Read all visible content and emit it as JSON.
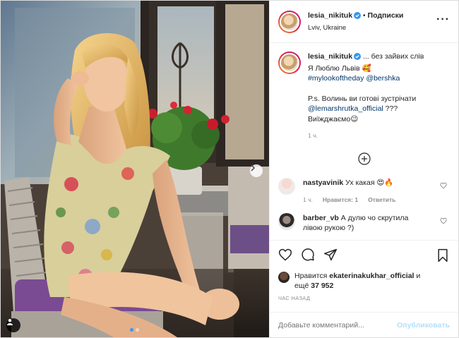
{
  "header": {
    "username": "lesia_nikituk",
    "separator": "•",
    "follow_label": "Подписки",
    "location": "Lviv, Ukraine"
  },
  "caption": {
    "username": "lesia_nikituk",
    "line1": " ... без зайвих слів",
    "line2": "Я Люблю Львів",
    "line2_emoji": "🥰",
    "hashtag": "#mylookoftheday",
    "mention": "@bershka",
    "line4": "P.s. Волинь ви готові зустрічати",
    "mention2": "@lemarshrutka_official",
    "line5_suffix": " ???",
    "line6": "Виїжджаємо",
    "line6_emoji": "😉",
    "time": "1 ч."
  },
  "comments": [
    {
      "username": "nastyavinik",
      "text": " Ух какая ",
      "emoji": "😍🔥",
      "time": "1 ч.",
      "likes": "Нравится: 1",
      "reply": "Ответить"
    },
    {
      "username": "barber_vb",
      "text": " А дулю чо скрутила лівою рукою ?)"
    }
  ],
  "likes": {
    "prefix": "Нравится ",
    "user": "ekaterinakukhar_official",
    "middle": " и",
    "count_prefix": "ещё ",
    "count": "37 952"
  },
  "timestamp": "ЧАС НАЗАД",
  "add_comment": {
    "placeholder": "Добавьте комментарий...",
    "post_label": "Опубликовать"
  },
  "colors": {
    "link": "#00376b",
    "verified": "#3897f0",
    "post_disabled": "#b2dffc",
    "muted": "#8e8e8e"
  },
  "icons": [
    "verified-icon",
    "more-icon",
    "add-circle-icon",
    "heart-icon",
    "comment-icon",
    "share-icon",
    "bookmark-icon",
    "chevron-right-icon",
    "tag-user-icon"
  ]
}
